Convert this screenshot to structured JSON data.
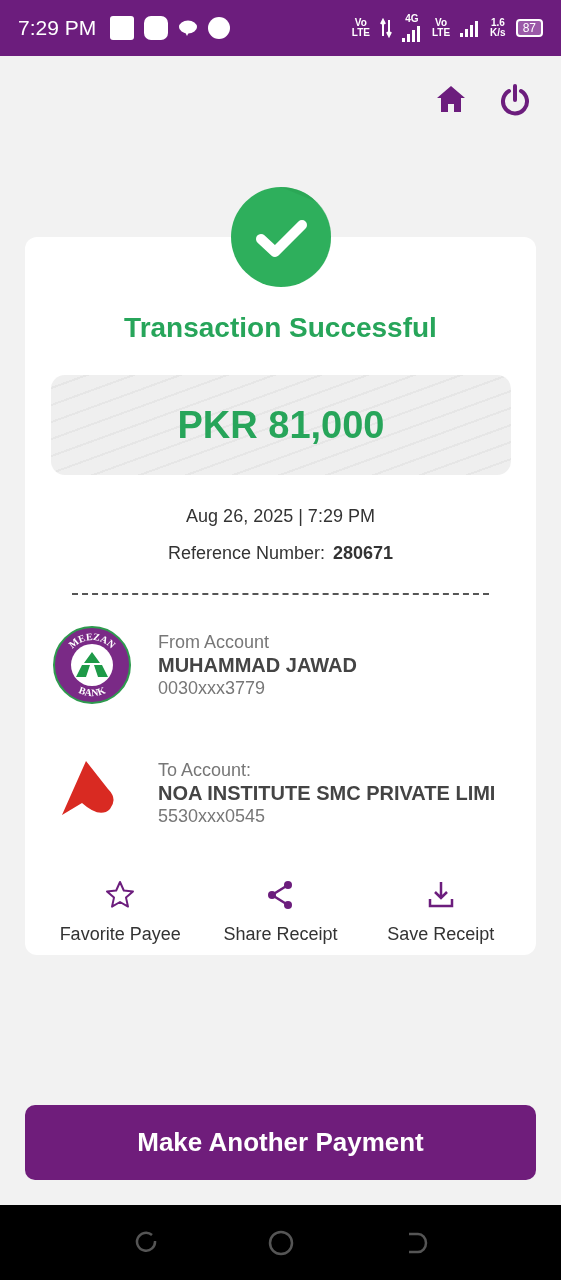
{
  "status_bar": {
    "time": "7:29 PM",
    "volte_1": [
      "Vo",
      "LTE"
    ],
    "network": "4G",
    "volte_2": [
      "Vo",
      "LTE"
    ],
    "speed": [
      "1.6",
      "K/s"
    ],
    "battery": "87"
  },
  "header": {
    "buttons": [
      {
        "kind": "home"
      },
      {
        "kind": "power"
      }
    ]
  },
  "receipt": {
    "title": "Transaction Successful",
    "amount": "PKR 81,000",
    "date": "Aug 26, 2025 | 7:29 PM",
    "reference_label": "Reference Number:",
    "reference_value": "280671",
    "accounts": [
      {
        "kind": "meezan",
        "logo_top": "MEEZAN",
        "logo_bottom": "BANK",
        "label": "From Account",
        "name": "MUHAMMAD JAWAD",
        "number": "0030xxx3779"
      },
      {
        "kind": "arrow",
        "label": "To Account:",
        "name": "NOA INSTITUTE SMC PRIVATE LIMI",
        "number": "5530xxx0545"
      }
    ],
    "actions": [
      {
        "kind": "star",
        "label": "Favorite Payee"
      },
      {
        "kind": "share",
        "label": "Share Receipt"
      },
      {
        "kind": "download",
        "label": "Save Receipt"
      }
    ]
  },
  "primary_button": "Make Another Payment"
}
